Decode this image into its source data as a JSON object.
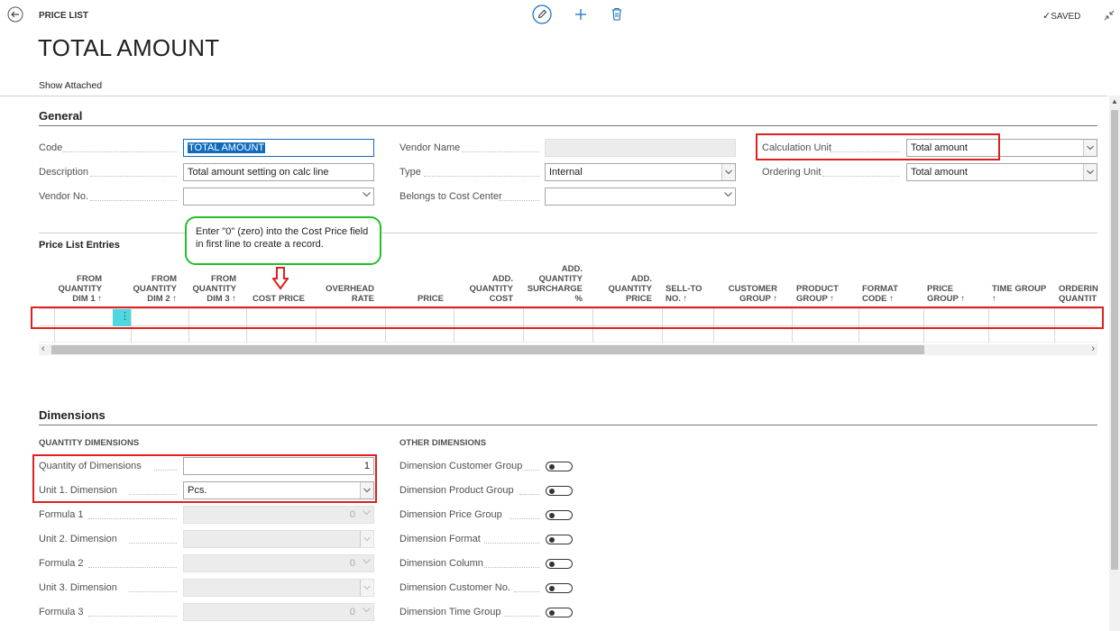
{
  "header": {
    "breadcrumb": "PRICE LIST",
    "title": "TOTAL AMOUNT",
    "saved": "SAVED",
    "show_attached": "Show Attached"
  },
  "general": {
    "title": "General",
    "fields": {
      "code": {
        "label": "Code",
        "value": "TOTAL AMOUNT"
      },
      "description": {
        "label": "Description",
        "value": "Total amount setting on calc line"
      },
      "vendor_no": {
        "label": "Vendor No.",
        "value": ""
      },
      "vendor_name": {
        "label": "Vendor Name",
        "value": ""
      },
      "type": {
        "label": "Type",
        "value": "Internal"
      },
      "belongs_cost_center": {
        "label": "Belongs to Cost Center",
        "value": ""
      },
      "calculation_unit": {
        "label": "Calculation Unit",
        "value": "Total amount"
      },
      "ordering_unit": {
        "label": "Ordering Unit",
        "value": "Total amount"
      }
    }
  },
  "entries": {
    "title": "Price List Entries",
    "callout": "Enter \"0\" (zero) into the Cost Price field in first line to create a record.",
    "columns": [
      {
        "l1": "FROM",
        "l2": "QUANTITY",
        "l3": "DIM 1 ↑"
      },
      {
        "l1": "FROM",
        "l2": "QUANTITY",
        "l3": "DIM 2 ↑"
      },
      {
        "l1": "FROM",
        "l2": "QUANTITY",
        "l3": "DIM 3 ↑"
      },
      {
        "l1": "",
        "l2": "",
        "l3": "COST PRICE"
      },
      {
        "l1": "",
        "l2": "OVERHEAD",
        "l3": "RATE"
      },
      {
        "l1": "",
        "l2": "",
        "l3": "PRICE"
      },
      {
        "l1": "ADD.",
        "l2": "QUANTITY",
        "l3": "COST"
      },
      {
        "l0": "ADD.",
        "l1": "QUANTITY",
        "l2": "SURCHARGE",
        "l3": "%"
      },
      {
        "l1": "ADD.",
        "l2": "QUANTITY",
        "l3": "PRICE"
      },
      {
        "l1": "",
        "l2": "SELL-TO",
        "l3": "NO. ↑"
      },
      {
        "l1": "",
        "l2": "CUSTOMER",
        "l3": "GROUP ↑"
      },
      {
        "l1": "",
        "l2": "PRODUCT",
        "l3": "GROUP ↑"
      },
      {
        "l1": "",
        "l2": "FORMAT",
        "l3": "CODE ↑"
      },
      {
        "l1": "",
        "l2": "PRICE",
        "l3": "GROUP ↑"
      },
      {
        "l1": "",
        "l2": "TIME GROUP",
        "l3": "↑"
      },
      {
        "l1": "",
        "l2": "ORDERIN",
        "l3": "QUANTIT"
      }
    ]
  },
  "dimensions": {
    "title": "Dimensions",
    "qty_title": "QUANTITY DIMENSIONS",
    "other_title": "OTHER DIMENSIONS",
    "qty_fields": [
      {
        "label": "Quantity of Dimensions",
        "value": "1"
      },
      {
        "label": "Unit 1. Dimension",
        "value": "Pcs."
      },
      {
        "label": "Formula 1",
        "value": "0"
      },
      {
        "label": "Unit 2. Dimension",
        "value": ""
      },
      {
        "label": "Formula 2",
        "value": "0"
      },
      {
        "label": "Unit 3. Dimension",
        "value": ""
      },
      {
        "label": "Formula 3",
        "value": "0"
      }
    ],
    "other_fields": [
      {
        "label": "Dimension Customer Group"
      },
      {
        "label": "Dimension Product Group"
      },
      {
        "label": "Dimension Price Group"
      },
      {
        "label": "Dimension Format"
      },
      {
        "label": "Dimension Column"
      },
      {
        "label": "Dimension Customer No."
      },
      {
        "label": "Dimension Time Group"
      }
    ]
  },
  "colors": {
    "accent": "#0f6cbd",
    "highlight": "#e02020",
    "callout": "#22c02a",
    "cell_active": "#4dd8e0"
  }
}
